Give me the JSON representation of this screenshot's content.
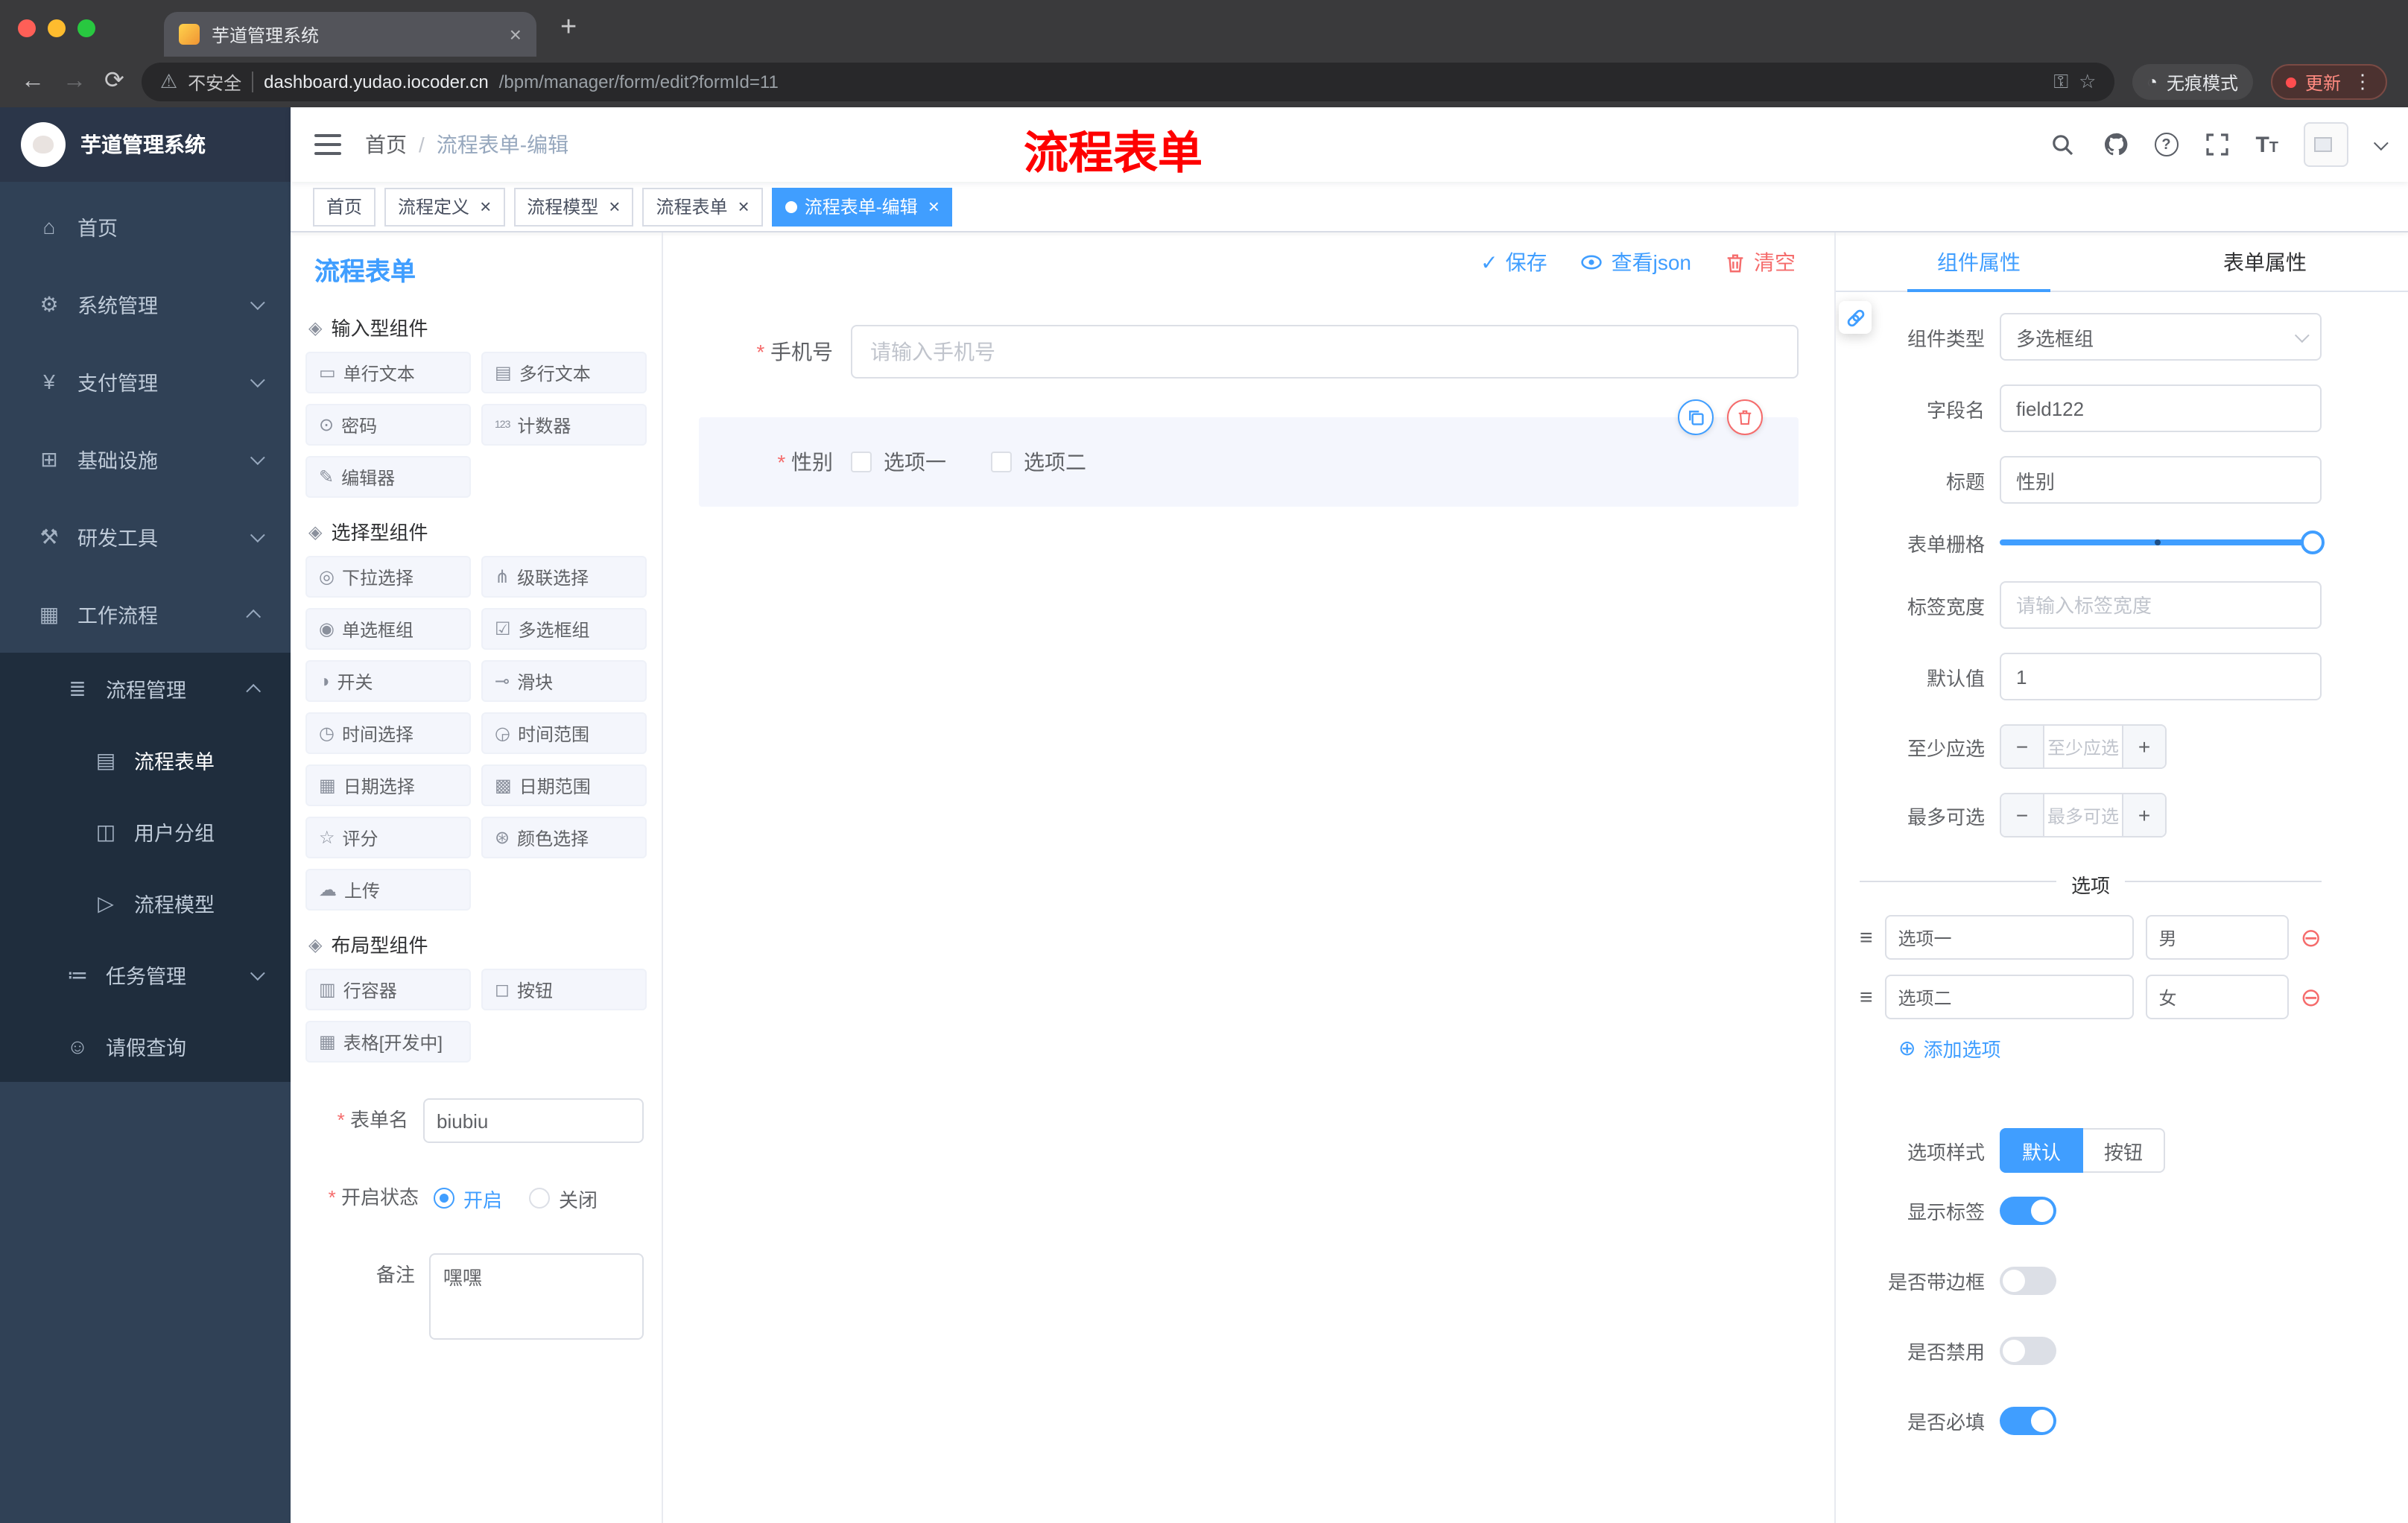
{
  "browser": {
    "tab_title": "芋道管理系统",
    "url_security": "不安全",
    "url_domain": "dashboard.yudao.iocoder.cn",
    "url_path": "/bpm/manager/form/edit?formId=11",
    "incognito": "无痕模式",
    "update": "更新"
  },
  "sidebar": {
    "logo_title": "芋道管理系统",
    "items": [
      {
        "label": "首页",
        "icon": "home-icon",
        "depth": 0
      },
      {
        "label": "系统管理",
        "icon": "gear-icon",
        "depth": 0,
        "chevron": "down"
      },
      {
        "label": "支付管理",
        "icon": "yen-icon",
        "depth": 0,
        "chevron": "down"
      },
      {
        "label": "基础设施",
        "icon": "infrastructure-icon",
        "depth": 0,
        "chevron": "down"
      },
      {
        "label": "研发工具",
        "icon": "devtools-icon",
        "depth": 0,
        "chevron": "down"
      },
      {
        "label": "工作流程",
        "icon": "workflow-icon",
        "depth": 0,
        "chevron": "up"
      },
      {
        "label": "流程管理",
        "icon": "process-list-icon",
        "depth": 1,
        "chevron": "up",
        "dark": true
      },
      {
        "label": "流程表单",
        "icon": "process-form-icon",
        "depth": 2,
        "dark": true,
        "active": true
      },
      {
        "label": "用户分组",
        "icon": "user-group-icon",
        "depth": 2,
        "dark": true
      },
      {
        "label": "流程模型",
        "icon": "process-model-icon",
        "depth": 2,
        "dark": true
      },
      {
        "label": "任务管理",
        "icon": "task-icon",
        "depth": 1,
        "chevron": "down",
        "dark": true
      },
      {
        "label": "请假查询",
        "icon": "person-icon",
        "depth": 1,
        "dark": true
      }
    ]
  },
  "navbar": {
    "breadcrumb_home": "首页",
    "breadcrumb_current": "流程表单-编辑",
    "annotation": "流程表单"
  },
  "tags": [
    {
      "label": "首页"
    },
    {
      "label": "流程定义",
      "closable": true
    },
    {
      "label": "流程模型",
      "closable": true
    },
    {
      "label": "流程表单",
      "closable": true
    },
    {
      "label": "流程表单-编辑",
      "closable": true,
      "active": true
    }
  ],
  "palette": {
    "title": "流程表单",
    "sections": [
      {
        "title": "输入型组件",
        "icon": "component-icon",
        "items": [
          {
            "label": "单行文本",
            "icon": "single-text-icon"
          },
          {
            "label": "多行文本",
            "icon": "multi-text-icon"
          },
          {
            "label": "密码",
            "icon": "password-icon"
          },
          {
            "label": "计数器",
            "icon": "counter-icon"
          },
          {
            "label": "编辑器",
            "icon": "editor-icon"
          }
        ]
      },
      {
        "title": "选择型组件",
        "icon": "component-icon",
        "items": [
          {
            "label": "下拉选择",
            "icon": "select-icon"
          },
          {
            "label": "级联选择",
            "icon": "cascader-icon"
          },
          {
            "label": "单选框组",
            "icon": "radio-group-icon"
          },
          {
            "label": "多选框组",
            "icon": "checkbox-group-icon"
          },
          {
            "label": "开关",
            "icon": "switch-icon"
          },
          {
            "label": "滑块",
            "icon": "slider-icon"
          },
          {
            "label": "时间选择",
            "icon": "time-icon"
          },
          {
            "label": "时间范围",
            "icon": "time-range-icon"
          },
          {
            "label": "日期选择",
            "icon": "date-icon"
          },
          {
            "label": "日期范围",
            "icon": "date-range-icon"
          },
          {
            "label": "评分",
            "icon": "rate-icon"
          },
          {
            "label": "颜色选择",
            "icon": "color-icon"
          },
          {
            "label": "上传",
            "icon": "upload-icon"
          }
        ]
      },
      {
        "title": "布局型组件",
        "icon": "component-icon",
        "items": [
          {
            "label": "行容器",
            "icon": "row-container-icon"
          },
          {
            "label": "按钮",
            "icon": "button-icon"
          },
          {
            "label": "表格[开发中]",
            "icon": "table-icon"
          }
        ]
      }
    ],
    "meta": {
      "name_label": "表单名",
      "name_value": "biubiu",
      "status_label": "开启状态",
      "status_options": [
        {
          "label": "开启",
          "selected": true
        },
        {
          "label": "关闭",
          "selected": false
        }
      ],
      "remark_label": "备注",
      "remark_value": "嘿嘿"
    }
  },
  "canvas": {
    "toolbar": {
      "save": "保存",
      "view_json": "查看json",
      "clear": "清空"
    },
    "phone_field": {
      "label": "手机号",
      "placeholder": "请输入手机号"
    },
    "gender_field": {
      "label": "性别",
      "options": [
        "选项一",
        "选项二"
      ]
    }
  },
  "props": {
    "tab_component": "组件属性",
    "tab_form": "表单属性",
    "rows": {
      "type_label": "组件类型",
      "type_value": "多选框组",
      "field_label": "字段名",
      "field_value": "field122",
      "title_label": "标题",
      "title_value": "性别",
      "grid_label": "表单栅格",
      "label_width_label": "标签宽度",
      "label_width_placeholder": "请输入标签宽度",
      "default_label": "默认值",
      "default_value": "1",
      "min_label": "至少应选",
      "min_placeholder": "至少应选",
      "max_label": "最多可选",
      "max_placeholder": "最多可选"
    },
    "options_title": "选项",
    "options": [
      {
        "name": "选项一",
        "value": "男"
      },
      {
        "name": "选项二",
        "value": "女"
      }
    ],
    "add_option": "添加选项",
    "style_label": "选项样式",
    "style_options": [
      {
        "label": "默认",
        "active": true
      },
      {
        "label": "按钮",
        "active": false
      }
    ],
    "toggles": [
      {
        "label": "显示标签",
        "on": true
      },
      {
        "label": "是否带边框",
        "on": false
      },
      {
        "label": "是否禁用",
        "on": false
      },
      {
        "label": "是否必填",
        "on": true
      }
    ]
  },
  "colors": {
    "primary": "#409eff",
    "danger": "#f56c6c",
    "annotation": "#fe0000",
    "sidebar": "#304156"
  }
}
